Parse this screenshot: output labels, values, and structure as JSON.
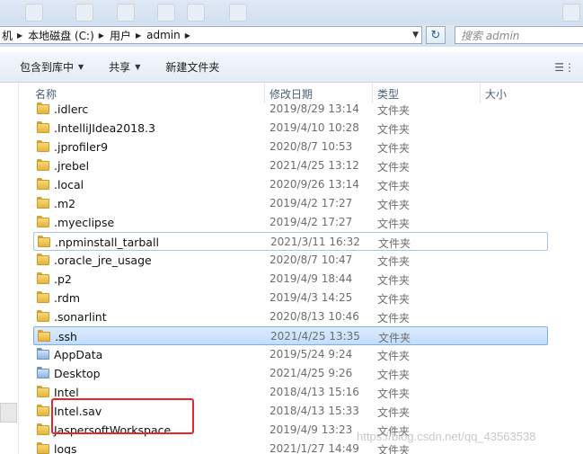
{
  "address": {
    "crumbs": [
      "机",
      "本地磁盘 (C:)",
      "用户",
      "admin"
    ],
    "search_placeholder": "搜索 admin"
  },
  "toolbar": {
    "include_library": "包含到库中",
    "share": "共享",
    "new_folder": "新建文件夹"
  },
  "columns": {
    "name": "名称",
    "modified": "修改日期",
    "type": "类型",
    "size": "大小"
  },
  "files": [
    {
      "name": ".idlerc",
      "date": "2019/8/29 13:14",
      "type": "文件夹"
    },
    {
      "name": ".IntelliJIdea2018.3",
      "date": "2019/4/10 10:28",
      "type": "文件夹"
    },
    {
      "name": ".jprofiler9",
      "date": "2020/8/7 10:53",
      "type": "文件夹"
    },
    {
      "name": ".jrebel",
      "date": "2021/4/25 13:12",
      "type": "文件夹"
    },
    {
      "name": ".local",
      "date": "2020/9/26 13:14",
      "type": "文件夹"
    },
    {
      "name": ".m2",
      "date": "2019/4/2 17:27",
      "type": "文件夹"
    },
    {
      "name": ".myeclipse",
      "date": "2019/4/2 17:27",
      "type": "文件夹"
    },
    {
      "name": ".npminstall_tarball",
      "date": "2021/3/11 16:32",
      "type": "文件夹"
    },
    {
      "name": ".oracle_jre_usage",
      "date": "2020/8/7 10:47",
      "type": "文件夹"
    },
    {
      "name": ".p2",
      "date": "2019/4/9 18:44",
      "type": "文件夹"
    },
    {
      "name": ".rdm",
      "date": "2019/4/3 14:25",
      "type": "文件夹"
    },
    {
      "name": ".sonarlint",
      "date": "2020/8/13 10:46",
      "type": "文件夹"
    },
    {
      "name": ".ssh",
      "date": "2021/4/25 13:35",
      "type": "文件夹"
    },
    {
      "name": "AppData",
      "date": "2019/5/24 9:24",
      "type": "文件夹"
    },
    {
      "name": "Desktop",
      "date": "2021/4/25 9:26",
      "type": "文件夹"
    },
    {
      "name": "Intel",
      "date": "2018/4/13 15:16",
      "type": "文件夹"
    },
    {
      "name": "Intel.sav",
      "date": "2018/4/13 15:33",
      "type": "文件夹"
    },
    {
      "name": "JaspersoftWorkspace",
      "date": "2019/4/9 13:23",
      "type": "文件夹"
    },
    {
      "name": "logs",
      "date": "2021/1/27 14:49",
      "type": "文件夹"
    }
  ],
  "selected_file": ".ssh",
  "watermark": "https://blog.csdn.net/qq_43563538"
}
